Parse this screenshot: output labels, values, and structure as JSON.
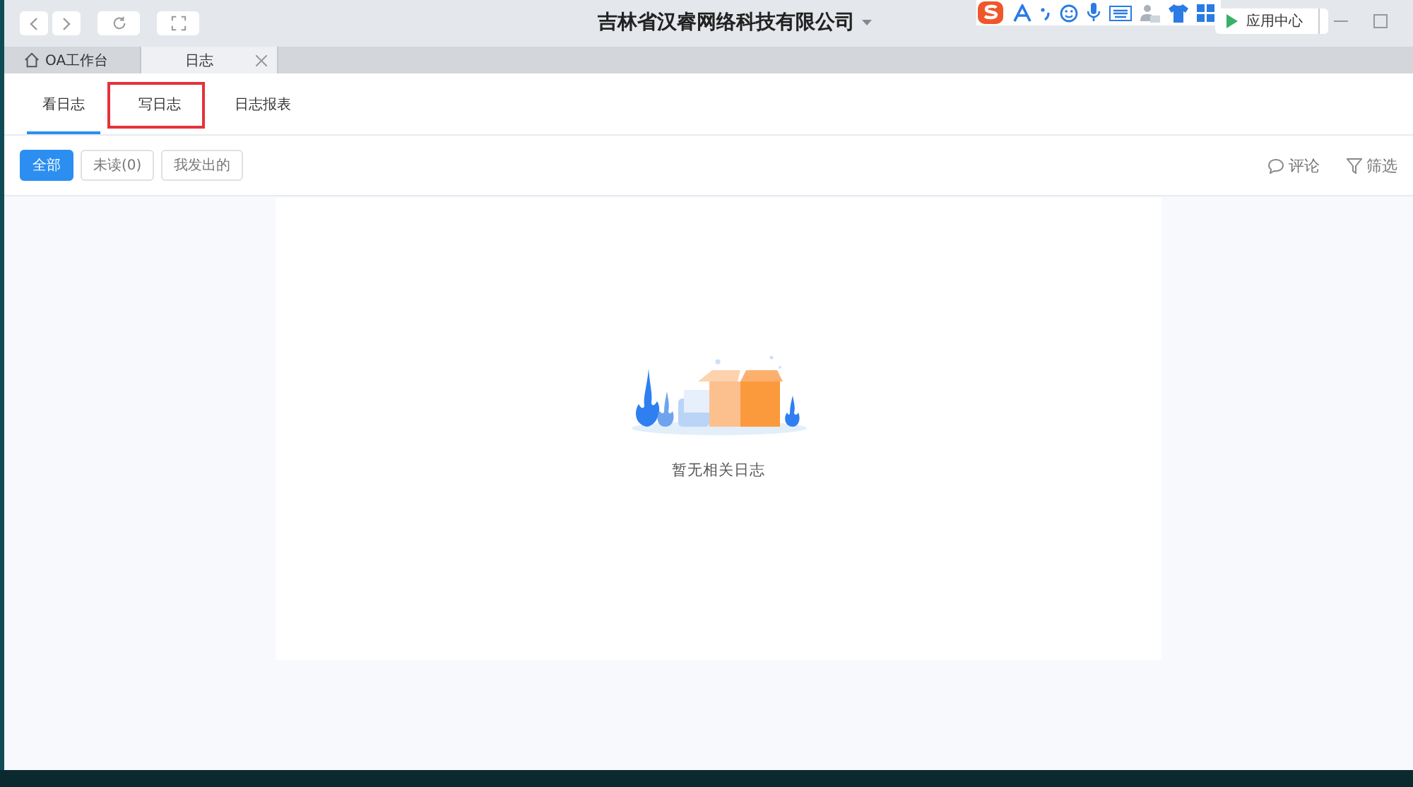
{
  "window": {
    "title": "吉林省汉睿网络科技有限公司",
    "app_center": "应用中心"
  },
  "doc_tabs": [
    {
      "label": "OA工作台",
      "selected": false,
      "kind": "home"
    },
    {
      "label": "日志",
      "selected": true,
      "kind": "closable"
    }
  ],
  "tabs": [
    {
      "label": "看日志",
      "selected": true,
      "highlighted": false
    },
    {
      "label": "写日志",
      "selected": false,
      "highlighted": true
    },
    {
      "label": "日志报表",
      "selected": false,
      "highlighted": false
    }
  ],
  "filters": [
    {
      "label": "全部",
      "selected": true
    },
    {
      "label": "未读(0)",
      "selected": false
    },
    {
      "label": "我发出的",
      "selected": false
    }
  ],
  "actions": [
    {
      "label": "评论",
      "kind": "comment"
    },
    {
      "label": "筛选",
      "kind": "filter"
    }
  ],
  "empty": {
    "message": "暂无相关日志"
  }
}
